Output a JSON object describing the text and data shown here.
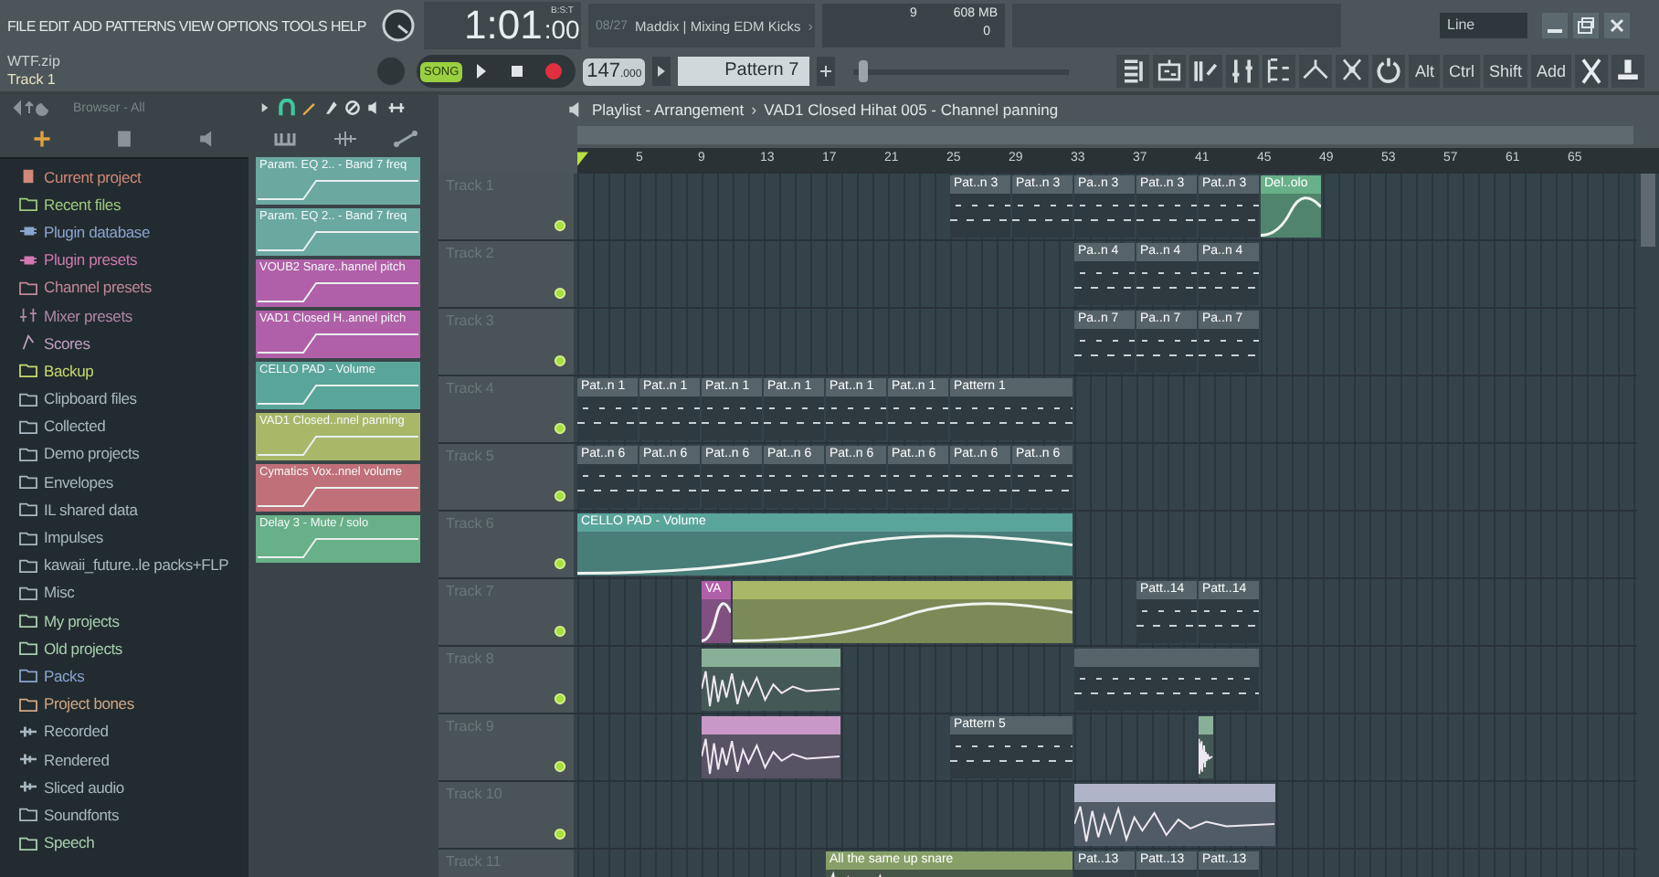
{
  "menu": [
    "FILE",
    "EDIT",
    "ADD",
    "PATTERNS",
    "VIEW",
    "OPTIONS",
    "TOOLS",
    "HELP"
  ],
  "time": {
    "main": "1:01",
    "sub": ":00",
    "unit": "B:S:T"
  },
  "hint": {
    "counter": "08/27",
    "text": "Maddix | Mixing EDM Kicks",
    "arrow": "›"
  },
  "monitor": {
    "cpu": "9",
    "memory": "608 MB",
    "polyphony": "0"
  },
  "snap": {
    "value": "Line"
  },
  "project": {
    "file": "WTF.zip",
    "track": "Track 1"
  },
  "transport": {
    "mode": "SONG",
    "tempo_main": "147",
    "tempo_frac": ".000",
    "pattern": "Pattern 7"
  },
  "master_slider": {
    "level": 0.02
  },
  "toolbar_keys": [
    "Alt",
    "Ctrl",
    "Shift",
    "Add"
  ],
  "browser": {
    "title": "Browser - All",
    "items": [
      {
        "label": "Current project",
        "color": "#d08878",
        "kind": "file"
      },
      {
        "label": "Recent files",
        "color": "#9cc880",
        "kind": "folder"
      },
      {
        "label": "Plugin database",
        "color": "#8aa4d0",
        "kind": "plug"
      },
      {
        "label": "Plugin presets",
        "color": "#d078b0",
        "kind": "plug"
      },
      {
        "label": "Channel presets",
        "color": "#c08898",
        "kind": "folder"
      },
      {
        "label": "Mixer presets",
        "color": "#b088a8",
        "kind": "mixer"
      },
      {
        "label": "Scores",
        "color": "#c0a0c0",
        "kind": "note"
      },
      {
        "label": "Backup",
        "color": "#c8d870",
        "kind": "folder"
      },
      {
        "label": "Clipboard files",
        "color": "#a8b8c0",
        "kind": "folder"
      },
      {
        "label": "Collected",
        "color": "#a8b8c0",
        "kind": "folder"
      },
      {
        "label": "Demo projects",
        "color": "#a8b8c0",
        "kind": "folder"
      },
      {
        "label": "Envelopes",
        "color": "#a8b8c0",
        "kind": "folder"
      },
      {
        "label": "IL shared data",
        "color": "#a8b8c0",
        "kind": "folder"
      },
      {
        "label": "Impulses",
        "color": "#a8b8c0",
        "kind": "folder"
      },
      {
        "label": "kawaii_future..le packs+FLP",
        "color": "#a8b8c0",
        "kind": "folder"
      },
      {
        "label": "Misc",
        "color": "#a8b8c0",
        "kind": "folder"
      },
      {
        "label": "My projects",
        "color": "#a8d0b0",
        "kind": "folder"
      },
      {
        "label": "Old projects",
        "color": "#a8d0b0",
        "kind": "folder"
      },
      {
        "label": "Packs",
        "color": "#8aa4d0",
        "kind": "folder"
      },
      {
        "label": "Project bones",
        "color": "#d0a888",
        "kind": "folder"
      },
      {
        "label": "Recorded",
        "color": "#a8b8c0",
        "kind": "audio"
      },
      {
        "label": "Rendered",
        "color": "#a8b8c0",
        "kind": "audio"
      },
      {
        "label": "Sliced audio",
        "color": "#a8b8c0",
        "kind": "audio"
      },
      {
        "label": "Soundfonts",
        "color": "#a8b8c0",
        "kind": "folder"
      },
      {
        "label": "Speech",
        "color": "#a8d0b0",
        "kind": "folder"
      }
    ]
  },
  "clip_source": [
    {
      "label": "Param. EQ 2.. - Band 7 freq",
      "color": "#6aa8a0"
    },
    {
      "label": "Param. EQ 2.. - Band 7 freq",
      "color": "#6aa8a0"
    },
    {
      "label": "VOUB2 Snare..hannel pitch",
      "color": "#b060a8"
    },
    {
      "label": "VAD1 Closed H..annel pitch",
      "color": "#b060a8"
    },
    {
      "label": "CELLO PAD - Volume",
      "color": "#5aa59a"
    },
    {
      "label": "VAD1 Closed..nnel panning",
      "color": "#a8b868"
    },
    {
      "label": "Cymatics Vox..nnel volume",
      "color": "#c07078"
    },
    {
      "label": "Delay 3 - Mute / solo",
      "color": "#68b088"
    }
  ],
  "playlist": {
    "title": "Playlist - Arrangement",
    "separator": "›",
    "target": "VAD1 Closed Hihat 005 - Channel panning",
    "ruler": [
      "5",
      "9",
      "13",
      "17",
      "21",
      "25",
      "29",
      "33",
      "37",
      "41",
      "45",
      "49",
      "53",
      "57",
      "61",
      "65"
    ],
    "tracks": [
      {
        "name": "Track 1",
        "clips": [
          {
            "kind": "pattern",
            "label": "Pat..n 3"
          },
          {
            "kind": "pattern",
            "label": "Pat..n 3"
          },
          {
            "kind": "pattern",
            "label": "Pa..n 3"
          },
          {
            "kind": "pattern",
            "label": "Pat..n 3"
          },
          {
            "kind": "pattern",
            "label": "Pat..n 3"
          },
          {
            "kind": "automation",
            "label": "Del..olo",
            "color": "#68b088"
          }
        ]
      },
      {
        "name": "Track 2",
        "clips": [
          {
            "kind": "pattern",
            "label": "Pa..n 4"
          },
          {
            "kind": "pattern",
            "label": "Pa..n 4"
          },
          {
            "kind": "pattern",
            "label": "Pa..n 4"
          }
        ]
      },
      {
        "name": "Track 3",
        "clips": [
          {
            "kind": "pattern",
            "label": "Pa..n 7"
          },
          {
            "kind": "pattern",
            "label": "Pa..n 7"
          },
          {
            "kind": "pattern",
            "label": "Pa..n 7"
          }
        ]
      },
      {
        "name": "Track 4",
        "clips": [
          {
            "kind": "pattern",
            "label": "Pat..n 1"
          },
          {
            "kind": "pattern",
            "label": "Pat..n 1"
          },
          {
            "kind": "pattern",
            "label": "Pat..n 1"
          },
          {
            "kind": "pattern",
            "label": "Pat..n 1"
          },
          {
            "kind": "pattern",
            "label": "Pat..n 1"
          },
          {
            "kind": "pattern",
            "label": "Pat..n 1"
          },
          {
            "kind": "pattern",
            "label": "Pattern 1"
          }
        ]
      },
      {
        "name": "Track 5",
        "clips": [
          {
            "kind": "pattern",
            "label": "Pat..n 6"
          },
          {
            "kind": "pattern",
            "label": "Pat..n 6"
          },
          {
            "kind": "pattern",
            "label": "Pat..n 6"
          },
          {
            "kind": "pattern",
            "label": "Pat..n 6"
          },
          {
            "kind": "pattern",
            "label": "Pat..n 6"
          },
          {
            "kind": "pattern",
            "label": "Pat..n 6"
          },
          {
            "kind": "pattern",
            "label": "Pat..n 6"
          },
          {
            "kind": "pattern",
            "label": "Pat..n 6"
          }
        ]
      },
      {
        "name": "Track 6",
        "clips": [
          {
            "kind": "automation",
            "label": "CELLO PAD - Volume",
            "color": "#5aa59a"
          }
        ]
      },
      {
        "name": "Track 7",
        "clips": [
          {
            "kind": "automation",
            "label": "VA",
            "color": "#b060a8"
          },
          {
            "kind": "automation",
            "color": "#a8b868"
          },
          {
            "kind": "pattern",
            "label": "Patt..14"
          },
          {
            "kind": "pattern",
            "label": "Patt..14"
          }
        ]
      },
      {
        "name": "Track 8",
        "clips": [
          {
            "kind": "audio",
            "color": "#88b098"
          },
          {
            "kind": "pattern"
          }
        ]
      },
      {
        "name": "Track 9",
        "clips": [
          {
            "kind": "audio",
            "color": "#c898c8"
          },
          {
            "kind": "pattern",
            "label": "Pattern 5"
          },
          {
            "kind": "audio",
            "color": "#88b098"
          }
        ]
      },
      {
        "name": "Track 10",
        "clips": [
          {
            "kind": "audio",
            "color": "#b0b4c8"
          }
        ]
      },
      {
        "name": "Track 11",
        "clips": [
          {
            "kind": "audio",
            "label": "All the same up snare",
            "color": "#88a068"
          },
          {
            "kind": "pattern",
            "label": "Pat..13"
          },
          {
            "kind": "pattern",
            "label": "Patt..13"
          },
          {
            "kind": "pattern",
            "label": "Patt..13"
          }
        ]
      }
    ]
  }
}
